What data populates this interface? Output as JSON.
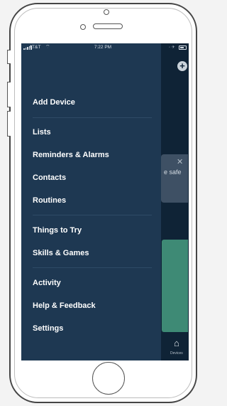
{
  "status_bar": {
    "carrier": "AT&T",
    "time": "7:22 PM"
  },
  "menu": {
    "groups": [
      [
        "Add Device"
      ],
      [
        "Lists",
        "Reminders & Alarms",
        "Contacts",
        "Routines"
      ],
      [
        "Things to Try",
        "Skills & Games"
      ],
      [
        "Activity",
        "Help & Feedback",
        "Settings"
      ]
    ]
  },
  "background": {
    "card_text": "e safe",
    "devices_label": "Devices"
  }
}
